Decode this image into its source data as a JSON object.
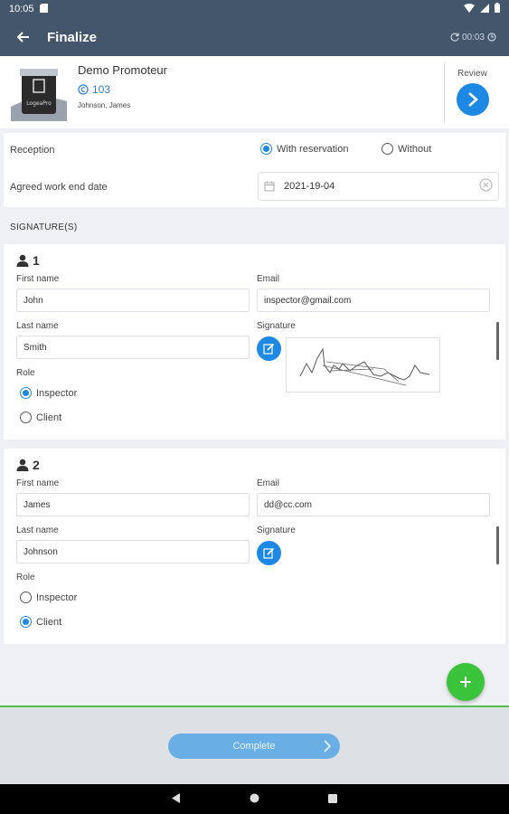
{
  "status_bar": {
    "time": "10:05"
  },
  "app_bar": {
    "title": "Finalize",
    "timer": "00:03"
  },
  "project": {
    "logo_text": "LogeaPro",
    "name": "Demo Promoteur",
    "count": "103",
    "user": "Johnson, James",
    "review_label": "Review"
  },
  "reception": {
    "label": "Reception",
    "options": [
      {
        "label": "With reservation",
        "selected": true
      },
      {
        "label": "Without",
        "selected": false
      }
    ],
    "date_label": "Agreed work end date",
    "date_value": "2021-19-04"
  },
  "signatures": {
    "heading": "SIGNATURE(S)",
    "labels": {
      "first_name": "First name",
      "last_name": "Last name",
      "email": "Email",
      "signature": "Signature",
      "role": "Role"
    },
    "items": [
      {
        "number": "1",
        "first_name": "John",
        "last_name": "Smith",
        "email": "inspector@gmail.com",
        "roles": [
          {
            "label": "Inspector",
            "selected": true
          },
          {
            "label": "Client",
            "selected": false
          }
        ],
        "has_signature": true
      },
      {
        "number": "2",
        "first_name": "James",
        "last_name": "Johnson",
        "email": "dd@cc.com",
        "roles": [
          {
            "label": "Inspector",
            "selected": false
          },
          {
            "label": "Client",
            "selected": true
          }
        ],
        "has_signature": false
      }
    ]
  },
  "footer": {
    "complete_label": "Complete"
  },
  "colors": {
    "header": "#44566c",
    "accent": "#1e88e5",
    "fab": "#3cc33c"
  }
}
